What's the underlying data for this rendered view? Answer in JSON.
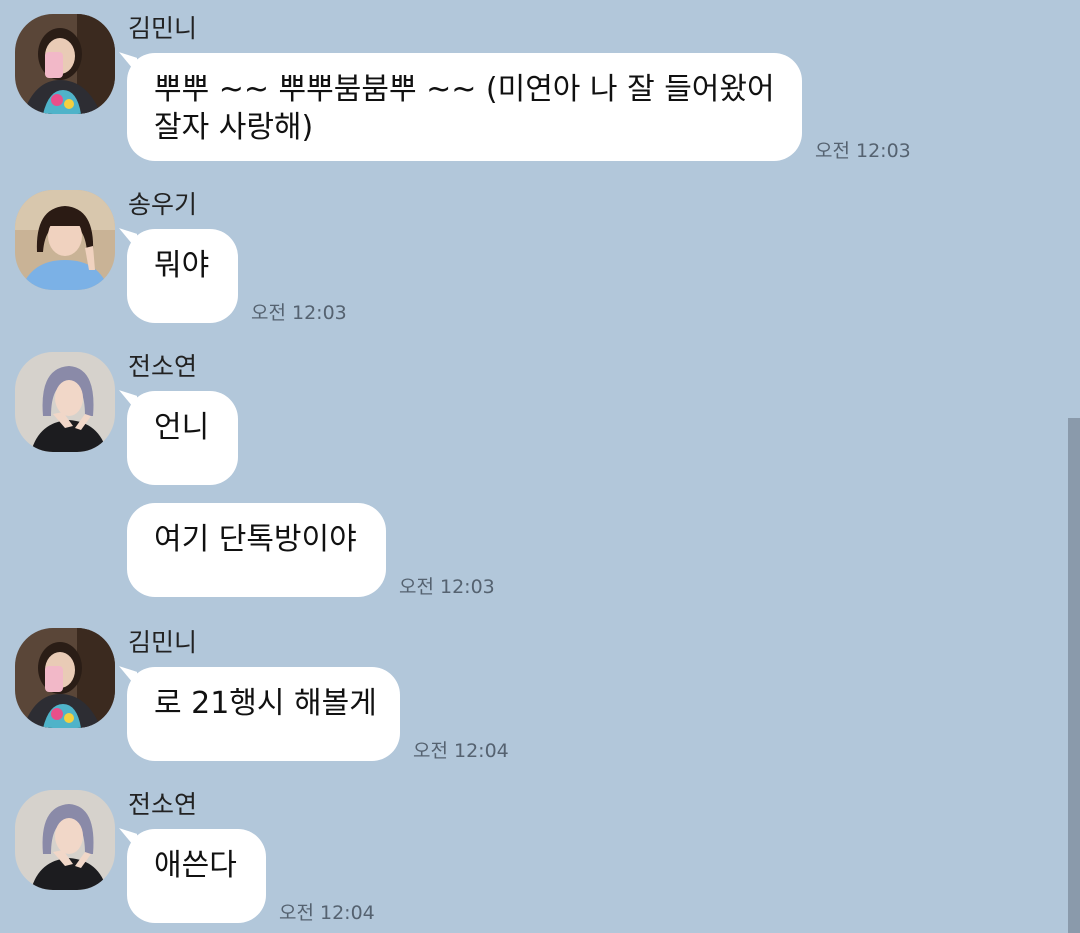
{
  "messages": [
    {
      "sender": "김민니",
      "text": "뿌뿌 ~~ 뿌뿌붐붐뿌 ~~ (미연아 나 잘 들어왔어\n잘자 사랑해)",
      "time": "오전 12:03"
    },
    {
      "sender": "송우기",
      "text": "뭐야",
      "time": "오전 12:03"
    },
    {
      "sender": "전소연",
      "text": "언니"
    },
    {
      "text": "여기 단톡방이야",
      "time": "오전 12:03"
    },
    {
      "sender": "김민니",
      "text": "로 21행시 해볼게",
      "time": "오전 12:04"
    },
    {
      "sender": "전소연",
      "text": "애쓴다",
      "time": "오전 12:04"
    }
  ],
  "colors": {
    "background": "#b2c7da",
    "bubble": "#ffffff",
    "time_text": "#556270",
    "scrollbar": "#8a9aab"
  }
}
